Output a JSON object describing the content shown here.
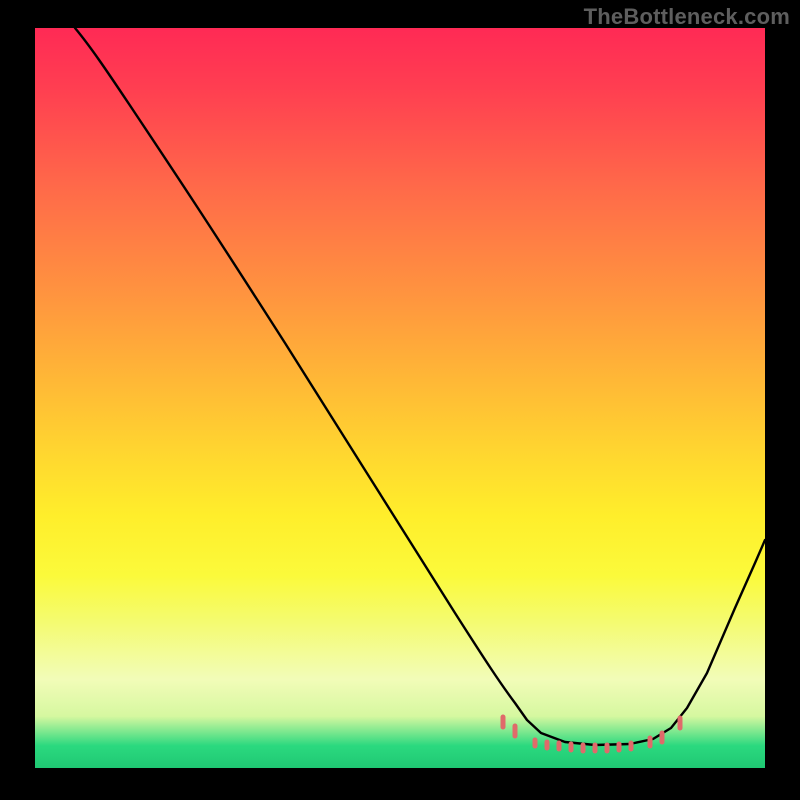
{
  "watermark": "TheBottleneck.com",
  "colors": {
    "background": "#000000",
    "curve": "#000000",
    "ticks": "#e06a6a",
    "watermark": "#5e5e5e"
  },
  "chart_data": {
    "type": "line",
    "title": "",
    "xlabel": "",
    "ylabel": "",
    "xlim": [
      0,
      730
    ],
    "ylim": [
      0,
      740
    ],
    "series": [
      {
        "name": "bottleneck-curve",
        "x": [
          40,
          65,
          100,
          160,
          250,
          340,
          420,
          460,
          480,
          510,
          560,
          605,
          640,
          680,
          720,
          730
        ],
        "y": [
          740,
          725,
          685,
          590,
          445,
          300,
          170,
          105,
          80,
          45,
          25,
          30,
          55,
          120,
          200,
          225
        ]
      }
    ],
    "annotations": {
      "tick_region_x": [
        460,
        645
      ],
      "tick_y_value": 30
    },
    "gradient_stops": [
      {
        "pos": 0.0,
        "color": "#ff2a55"
      },
      {
        "pos": 0.5,
        "color": "#ffd82f"
      },
      {
        "pos": 0.97,
        "color": "#2bd97f"
      }
    ]
  }
}
